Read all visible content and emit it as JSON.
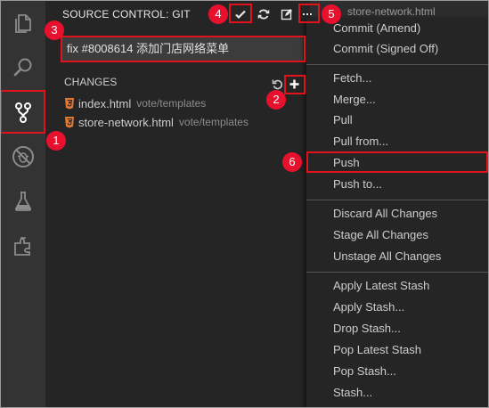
{
  "sidebar": {
    "title": "SOURCE CONTROL: GIT",
    "commit_message": "fix #8008614 添加门店网络菜单",
    "changes_header": "CHANGES",
    "files": [
      {
        "name": "index.html",
        "path": "vote/templates"
      },
      {
        "name": "store-network.html",
        "path": "vote/templates"
      }
    ]
  },
  "editor": {
    "tab_label": "store-network.html"
  },
  "menu": {
    "groups": [
      [
        "Commit (Amend)",
        "Commit (Signed Off)"
      ],
      [
        "Fetch...",
        "Merge...",
        "Pull",
        "Pull from...",
        "Push",
        "Push to..."
      ],
      [
        "Discard All Changes",
        "Stage All Changes",
        "Unstage All Changes"
      ],
      [
        "Apply Latest Stash",
        "Apply Stash...",
        "Drop Stash...",
        "Pop Latest Stash",
        "Pop Stash...",
        "Stash..."
      ]
    ]
  },
  "annotations": [
    "1",
    "2",
    "3",
    "4",
    "5",
    "6"
  ],
  "colors": {
    "accent_red": "#e0121b",
    "html_icon": "#e37933",
    "activity_bg": "#333333",
    "sidebar_bg": "#252526"
  }
}
